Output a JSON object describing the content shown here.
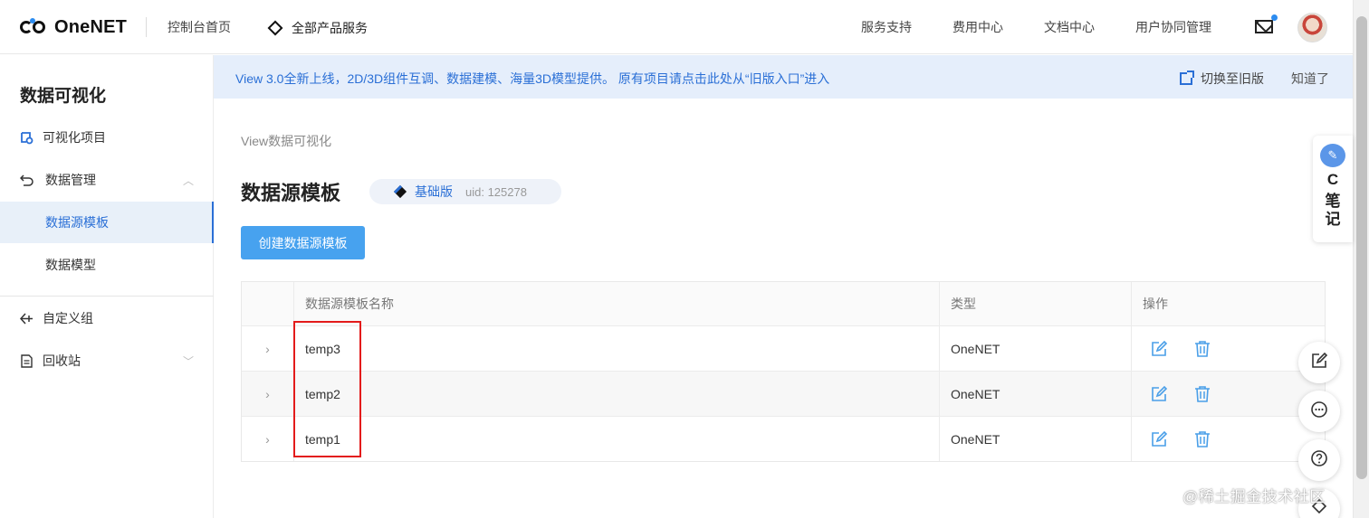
{
  "header": {
    "logo_text": "OneNET",
    "home_link": "控制台首页",
    "products_link": "全部产品服务",
    "nav": [
      "服务支持",
      "费用中心",
      "文档中心",
      "用户协同管理"
    ]
  },
  "sidebar": {
    "title": "数据可视化",
    "items": [
      {
        "label": "可视化项目",
        "icon": "visualization-icon"
      },
      {
        "label": "数据管理",
        "icon": "back-arrow-icon"
      },
      {
        "label": "数据源模板",
        "active": true
      },
      {
        "label": "数据模型"
      },
      {
        "label": "自定义组",
        "icon": "custom-group-icon"
      },
      {
        "label": "回收站",
        "icon": "recycle-bin-icon"
      }
    ]
  },
  "notice": {
    "text": "View 3.0全新上线，2D/3D组件互调、数据建模、海量3D模型提供。 原有项目请点击此处从“旧版入口”进入",
    "switch_label": "切换至旧版",
    "dismiss_label": "知道了"
  },
  "main": {
    "breadcrumb": "View数据可视化",
    "title": "数据源模板",
    "plan": "基础版",
    "uid": "uid: 125278",
    "create_button": "创建数据源模板"
  },
  "table": {
    "columns": [
      "数据源模板名称",
      "类型",
      "操作"
    ],
    "rows": [
      {
        "name": "temp3",
        "type": "OneNET"
      },
      {
        "name": "temp2",
        "type": "OneNET"
      },
      {
        "name": "temp1",
        "type": "OneNET"
      }
    ]
  },
  "widgets": {
    "note_letter": "C",
    "note_label": "笔记"
  },
  "watermark": "@稀土掘金技术社区",
  "colors": {
    "accent": "#2a6fd6",
    "button": "#47a2ef",
    "notice_bg": "#e5eefb",
    "highlight": "#e31b1b"
  }
}
